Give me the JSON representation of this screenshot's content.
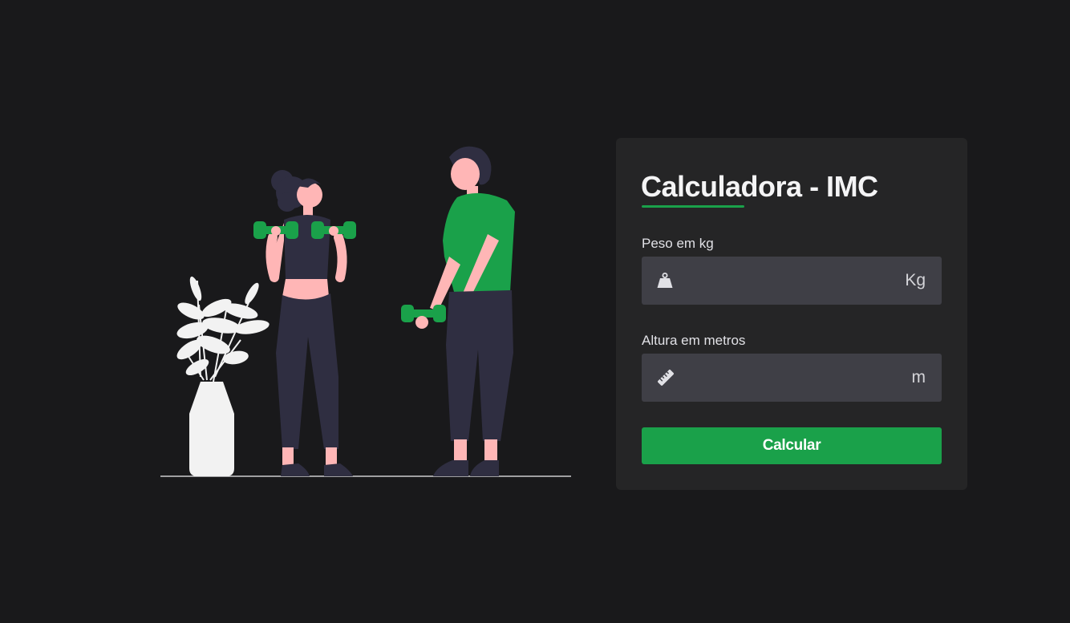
{
  "card": {
    "title": "Calculadora - IMC",
    "weight": {
      "label": "Peso em kg",
      "value": "",
      "placeholder": "",
      "unit": "Kg",
      "icon": "weight-icon"
    },
    "height": {
      "label": "Altura em metros",
      "value": "",
      "placeholder": "",
      "unit": "m",
      "icon": "ruler-icon"
    },
    "button_label": "Calcular"
  },
  "colors": {
    "background": "#19191b",
    "card": "#252526",
    "input": "#3f3f46",
    "accent": "#1aa14a",
    "skin": "#ffb6b6",
    "dark_clothes": "#2f2e41",
    "plant": "#f2f2f2"
  }
}
